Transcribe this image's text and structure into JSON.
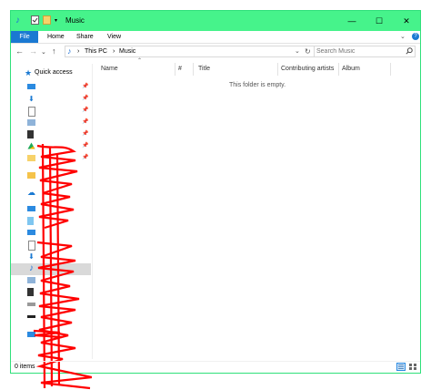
{
  "titlebar": {
    "title": "Music",
    "icons": [
      "music-note-icon",
      "checkbox-icon",
      "folder-icon",
      "dropdown-icon"
    ],
    "minimize": "—",
    "maximize": "☐",
    "close": "✕"
  },
  "ribbon": {
    "tabs": [
      "File",
      "Home",
      "Share",
      "View"
    ],
    "expand": "⌄",
    "help": "?"
  },
  "address": {
    "crumbs": [
      "This PC",
      "Music"
    ],
    "sep": "›",
    "back": "←",
    "forward": "→",
    "recent": "⌄",
    "up": "↑",
    "dropdown": "⌄",
    "refresh": "↻"
  },
  "search": {
    "placeholder": "Search Music",
    "icon": "search-icon"
  },
  "sidebar": {
    "quick_access_label": "Quick access",
    "pins": [
      "📌",
      "📌",
      "📌",
      "📌",
      "📌",
      "📌",
      "📌"
    ]
  },
  "columns": [
    "Name",
    "#",
    "Title",
    "Contributing artists",
    "Album"
  ],
  "content": {
    "empty_message": "This folder is empty."
  },
  "status": {
    "count": "0 items"
  },
  "colors": {
    "titlebar": "#46f38b",
    "file_tab": "#1a79d2",
    "selection": "#d9d9d9",
    "redaction": "#ff0000"
  }
}
